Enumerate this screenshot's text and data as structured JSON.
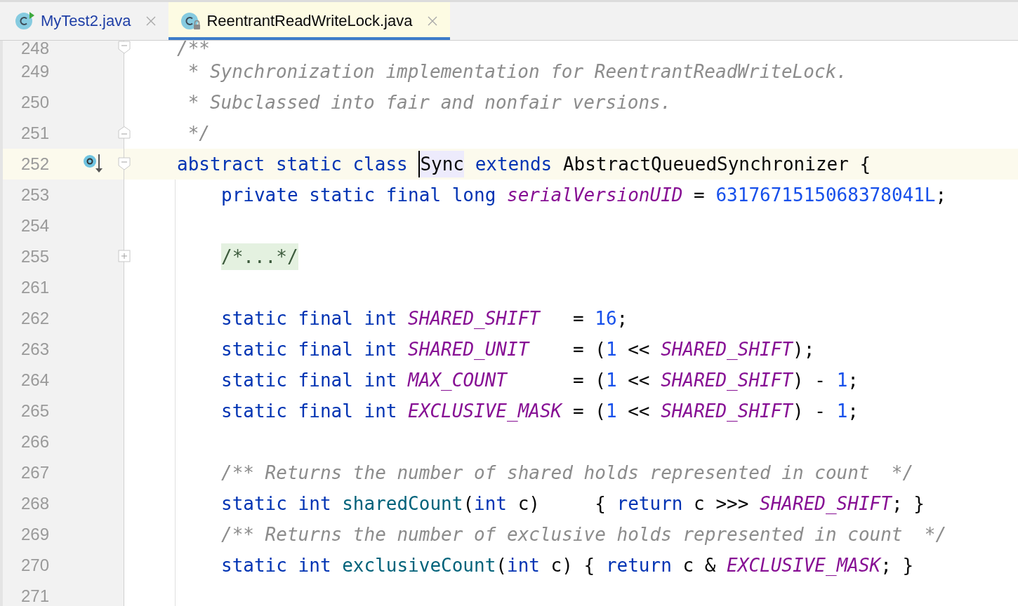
{
  "tabs": [
    {
      "label": "MyTest2.java",
      "selected": false,
      "color": "#1f3fa6",
      "badge": {
        "kind": "run"
      }
    },
    {
      "label": "ReentrantReadWriteLock.java",
      "selected": true,
      "color": "#080808",
      "badge": {
        "kind": "lock"
      }
    }
  ],
  "editor": {
    "lines": [
      {
        "number": "248",
        "current": false,
        "fold": {
          "kind": "open"
        },
        "guide": false,
        "short": true,
        "tokens": [
          {
            "kind": "comment",
            "text": "/**"
          }
        ]
      },
      {
        "number": "249",
        "current": false,
        "guide": false,
        "tokens": [
          {
            "kind": "comment",
            "text": " * Synchronization implementation for ReentrantReadWriteLock."
          }
        ]
      },
      {
        "number": "250",
        "current": false,
        "guide": false,
        "tokens": [
          {
            "kind": "comment",
            "text": " * Subclassed into fair and nonfair versions."
          }
        ]
      },
      {
        "number": "251",
        "current": false,
        "fold": {
          "kind": "close"
        },
        "guide": false,
        "tokens": [
          {
            "kind": "comment",
            "text": " */"
          }
        ]
      },
      {
        "number": "252",
        "current": true,
        "fold": {
          "kind": "open"
        },
        "marker": {
          "kind": "implemented"
        },
        "guide": false,
        "tokens": [
          {
            "kind": "kw",
            "text": "abstract static class "
          },
          {
            "kind": "caret-ident",
            "text": "Sync"
          },
          {
            "kind": "kw",
            "text": " extends"
          },
          {
            "kind": "plain",
            "text": " AbstractQueuedSynchronizer {"
          }
        ]
      },
      {
        "number": "253",
        "current": false,
        "guide": true,
        "tokens": [
          {
            "kind": "kw",
            "text": "private static final long "
          },
          {
            "kind": "field",
            "text": "serialVersionUID"
          },
          {
            "kind": "plain",
            "text": " = "
          },
          {
            "kind": "num",
            "text": "6317671515068378041L"
          },
          {
            "kind": "plain",
            "text": ";"
          }
        ]
      },
      {
        "number": "254",
        "current": false,
        "guide": true
      },
      {
        "number": "255",
        "current": false,
        "fold": {
          "kind": "collapsed"
        },
        "guide": true,
        "tokens": [
          {
            "kind": "folded",
            "text": "/*...*/"
          }
        ]
      },
      {
        "number": "261",
        "current": false,
        "guide": true
      },
      {
        "number": "262",
        "current": false,
        "guide": true,
        "tokens": [
          {
            "kind": "kw",
            "text": "static final int "
          },
          {
            "kind": "field",
            "text": "SHARED_SHIFT"
          },
          {
            "kind": "plain",
            "text": "   = "
          },
          {
            "kind": "num",
            "text": "16"
          },
          {
            "kind": "plain",
            "text": ";"
          }
        ]
      },
      {
        "number": "263",
        "current": false,
        "guide": true,
        "tokens": [
          {
            "kind": "kw",
            "text": "static final int "
          },
          {
            "kind": "field",
            "text": "SHARED_UNIT"
          },
          {
            "kind": "plain",
            "text": "    = ("
          },
          {
            "kind": "num",
            "text": "1"
          },
          {
            "kind": "plain",
            "text": " << "
          },
          {
            "kind": "field",
            "text": "SHARED_SHIFT"
          },
          {
            "kind": "plain",
            "text": ");"
          }
        ]
      },
      {
        "number": "264",
        "current": false,
        "guide": true,
        "tokens": [
          {
            "kind": "kw",
            "text": "static final int "
          },
          {
            "kind": "field",
            "text": "MAX_COUNT"
          },
          {
            "kind": "plain",
            "text": "      = ("
          },
          {
            "kind": "num",
            "text": "1"
          },
          {
            "kind": "plain",
            "text": " << "
          },
          {
            "kind": "field",
            "text": "SHARED_SHIFT"
          },
          {
            "kind": "plain",
            "text": ") - "
          },
          {
            "kind": "num",
            "text": "1"
          },
          {
            "kind": "plain",
            "text": ";"
          }
        ]
      },
      {
        "number": "265",
        "current": false,
        "guide": true,
        "tokens": [
          {
            "kind": "kw",
            "text": "static final int "
          },
          {
            "kind": "field",
            "text": "EXCLUSIVE_MASK"
          },
          {
            "kind": "plain",
            "text": " = ("
          },
          {
            "kind": "num",
            "text": "1"
          },
          {
            "kind": "plain",
            "text": " << "
          },
          {
            "kind": "field",
            "text": "SHARED_SHIFT"
          },
          {
            "kind": "plain",
            "text": ") - "
          },
          {
            "kind": "num",
            "text": "1"
          },
          {
            "kind": "plain",
            "text": ";"
          }
        ]
      },
      {
        "number": "266",
        "current": false,
        "guide": true
      },
      {
        "number": "267",
        "current": false,
        "guide": true,
        "tokens": [
          {
            "kind": "comment",
            "text": "/** Returns the number of shared holds represented in count  */"
          }
        ]
      },
      {
        "number": "268",
        "current": false,
        "guide": true,
        "tokens": [
          {
            "kind": "kw",
            "text": "static int "
          },
          {
            "kind": "method",
            "text": "sharedCount"
          },
          {
            "kind": "plain",
            "text": "("
          },
          {
            "kind": "kw",
            "text": "int"
          },
          {
            "kind": "plain",
            "text": " c)     { "
          },
          {
            "kind": "kw",
            "text": "return"
          },
          {
            "kind": "plain",
            "text": " c >>> "
          },
          {
            "kind": "field",
            "text": "SHARED_SHIFT"
          },
          {
            "kind": "plain",
            "text": "; }"
          }
        ]
      },
      {
        "number": "269",
        "current": false,
        "guide": true,
        "tokens": [
          {
            "kind": "comment",
            "text": "/** Returns the number of exclusive holds represented in count  */"
          }
        ]
      },
      {
        "number": "270",
        "current": false,
        "guide": true,
        "tokens": [
          {
            "kind": "kw",
            "text": "static int "
          },
          {
            "kind": "method",
            "text": "exclusiveCount"
          },
          {
            "kind": "plain",
            "text": "("
          },
          {
            "kind": "kw",
            "text": "int"
          },
          {
            "kind": "plain",
            "text": " c) { "
          },
          {
            "kind": "kw",
            "text": "return"
          },
          {
            "kind": "plain",
            "text": " c & "
          },
          {
            "kind": "field",
            "text": "EXCLUSIVE_MASK"
          },
          {
            "kind": "plain",
            "text": "; }"
          }
        ]
      },
      {
        "number": "271",
        "current": false,
        "guide": true
      }
    ]
  }
}
